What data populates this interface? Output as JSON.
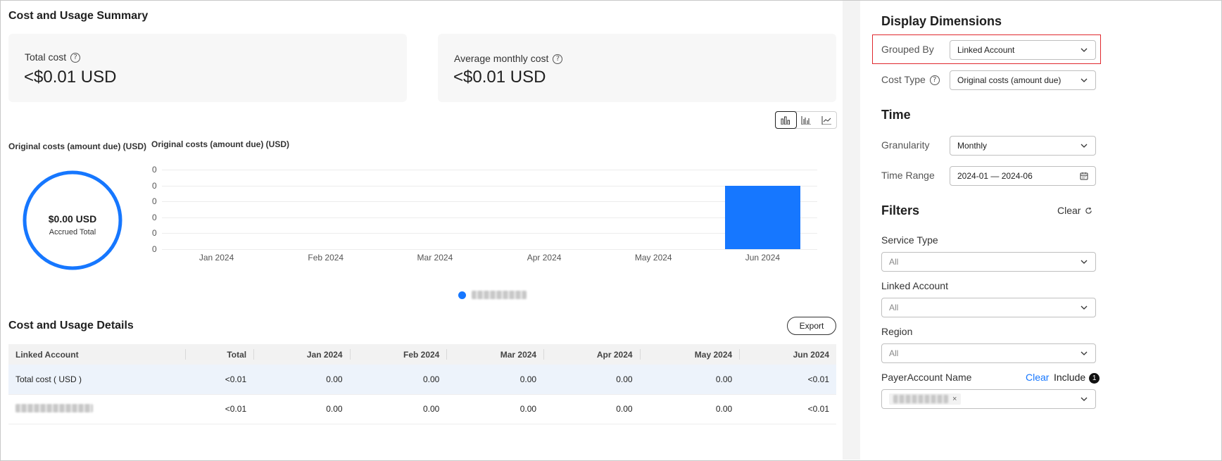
{
  "summary": {
    "title": "Cost and Usage Summary",
    "total_cost_label": "Total cost",
    "total_cost_value": "<$0.01 USD",
    "avg_cost_label": "Average monthly cost",
    "avg_cost_value": "<$0.01 USD"
  },
  "donut": {
    "title": "Original costs (amount due) (USD)",
    "value": "$0.00 USD",
    "caption": "Accrued Total",
    "color": "#1677ff"
  },
  "chart_toggle": {
    "icons": [
      "stacked-bar-icon",
      "grouped-bar-icon",
      "line-chart-icon"
    ],
    "active": "stacked-bar-icon"
  },
  "chart_data": {
    "type": "bar",
    "title": "Original costs (amount due) (USD)",
    "categories": [
      "Jan 2024",
      "Feb 2024",
      "Mar 2024",
      "Apr 2024",
      "May 2024",
      "Jun 2024"
    ],
    "y_ticks": [
      "0",
      "0",
      "0",
      "0",
      "0",
      "0"
    ],
    "series": [
      {
        "values": [
          0,
          0,
          0,
          0,
          0,
          0.004
        ]
      }
    ],
    "ylim": [
      0,
      0.005
    ],
    "grid": true,
    "legend": "bottom-center",
    "bar_color": "#1677ff"
  },
  "details": {
    "title": "Cost and Usage Details",
    "export_label": "Export",
    "columns": [
      "Linked Account",
      "Total",
      "Jan 2024",
      "Feb 2024",
      "Mar 2024",
      "Apr 2024",
      "May 2024",
      "Jun 2024"
    ],
    "rows": [
      [
        "Total cost ( USD )",
        "<0.01",
        "0.00",
        "0.00",
        "0.00",
        "0.00",
        "0.00",
        "<0.01"
      ],
      [
        "",
        "<0.01",
        "0.00",
        "0.00",
        "0.00",
        "0.00",
        "0.00",
        "<0.01"
      ]
    ]
  },
  "sidebar": {
    "display_title": "Display Dimensions",
    "grouped_by_label": "Grouped By",
    "grouped_by_value": "Linked Account",
    "cost_type_label": "Cost Type",
    "cost_type_value": "Original costs (amount due)",
    "time_title": "Time",
    "granularity_label": "Granularity",
    "granularity_value": "Monthly",
    "time_range_label": "Time Range",
    "time_range_value": "2024-01 — 2024-06",
    "filters_title": "Filters",
    "filters_clear": "Clear",
    "service_type_label": "Service Type",
    "service_type_value": "All",
    "linked_account_label": "Linked Account",
    "linked_account_value": "All",
    "region_label": "Region",
    "region_value": "All",
    "payer_label": "PayerAccount Name",
    "payer_clear": "Clear",
    "payer_include": "Include",
    "payer_count": "1",
    "highlight_color": "#e0282e"
  }
}
